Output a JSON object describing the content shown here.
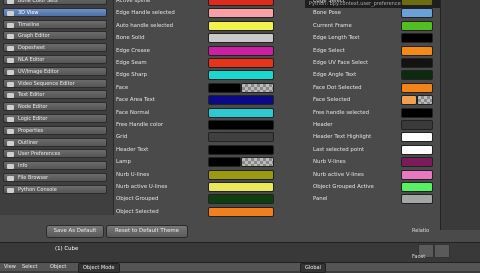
{
  "sidebar": {
    "items": [
      {
        "label": "Bone Color Sets",
        "active": false
      },
      {
        "label": "3D View",
        "active": true
      },
      {
        "label": "Timeline",
        "active": false
      },
      {
        "label": "Graph Editor",
        "active": false
      },
      {
        "label": "Dopesheet",
        "active": false
      },
      {
        "label": "NLA Editor",
        "active": false
      },
      {
        "label": "UV/Image Editor",
        "active": false
      },
      {
        "label": "Video Sequence Editor",
        "active": false
      },
      {
        "label": "Text Editor",
        "active": false
      },
      {
        "label": "Node Editor",
        "active": false
      },
      {
        "label": "Logic Editor",
        "active": false
      },
      {
        "label": "Properties",
        "active": false
      },
      {
        "label": "Outliner",
        "active": false
      },
      {
        "label": "User Preferences",
        "active": false
      },
      {
        "label": "Info",
        "active": false
      },
      {
        "label": "File Browser",
        "active": false
      },
      {
        "label": "Python Console",
        "active": false
      }
    ]
  },
  "columns": {
    "left": [
      {
        "label": "Active spline",
        "color": "#dd2a1a"
      },
      {
        "label": "Edge Handle selected",
        "color": "#f7a0a6"
      },
      {
        "label": "Auto handle selected",
        "color": "#f2f24a"
      },
      {
        "label": "Bone Solid",
        "color": "#c9c9c9"
      },
      {
        "label": "Edge Crease",
        "color": "#cc1fa4"
      },
      {
        "label": "Edge Seam",
        "color": "#e8331b"
      },
      {
        "label": "Edge Sharp",
        "color": "#1ad7d0"
      },
      {
        "label": "Face",
        "color": "#000000",
        "checker": true
      },
      {
        "label": "Face Area Text",
        "color": "#0a0a88"
      },
      {
        "label": "Face Normal",
        "color": "#2ec8d2"
      },
      {
        "label": "Free Handle color",
        "color": "#000000"
      },
      {
        "label": "Grid",
        "color": "#3f3f3f"
      },
      {
        "label": "Header Text",
        "color": "#000000"
      },
      {
        "label": "Lamp",
        "color": "#000000",
        "checker": true
      },
      {
        "label": "Nurb U-lines",
        "color": "#9a9a10"
      },
      {
        "label": "Nurb active U-lines",
        "color": "#e8e85a"
      },
      {
        "label": "Object Grouped",
        "color": "#0f3e0f"
      },
      {
        "label": "Object Selected",
        "color": "#f07f1c"
      }
    ],
    "right": [
      {
        "label": "Edge Select",
        "color": "#6b6b10"
      },
      {
        "label": "Bone Pose",
        "color": "#6aa1d8"
      },
      {
        "label": "Current Frame",
        "color": "#52be1f"
      },
      {
        "label": "Edge Length Text",
        "color": "#000000"
      },
      {
        "label": "Edge Select",
        "color": "#f28a1a"
      },
      {
        "label": "Edge UV Face Select",
        "color": "#131313"
      },
      {
        "label": "Edge Angle Text",
        "color": "#0c2a10"
      },
      {
        "label": "Face Dot Selected",
        "color": "#f2841a"
      },
      {
        "label": "Face Selected",
        "color": "#f0a050",
        "checker": true
      },
      {
        "label": "Free handle selected",
        "color": "#000000"
      },
      {
        "label": "Header",
        "color": "#3a3a3a"
      },
      {
        "label": "Header Text Highlight",
        "color": "#ffffff"
      },
      {
        "label": "Last selected point",
        "color": "#ffffff"
      },
      {
        "label": "Nurb V-lines",
        "color": "#7a1c5a"
      },
      {
        "label": "Nurb active V-lines",
        "color": "#e879c0"
      },
      {
        "label": "Object Grouped Active",
        "color": "#56f060"
      },
      {
        "label": "Panel",
        "color": "#a5a5a5"
      }
    ]
  },
  "tooltip": "Python: bpy.context.user_preferences.themes...",
  "buttons": {
    "save_default": "Save As Default",
    "reset_theme": "Reset to Default Theme"
  },
  "viewport": {
    "object_label": "(1) Cube"
  },
  "bottombar": {
    "view": "View",
    "select": "Select",
    "object": "Object",
    "mode": "Object Mode",
    "global": "Global"
  },
  "props": {
    "prop1": "Relatio",
    "prop2": "Facet"
  }
}
